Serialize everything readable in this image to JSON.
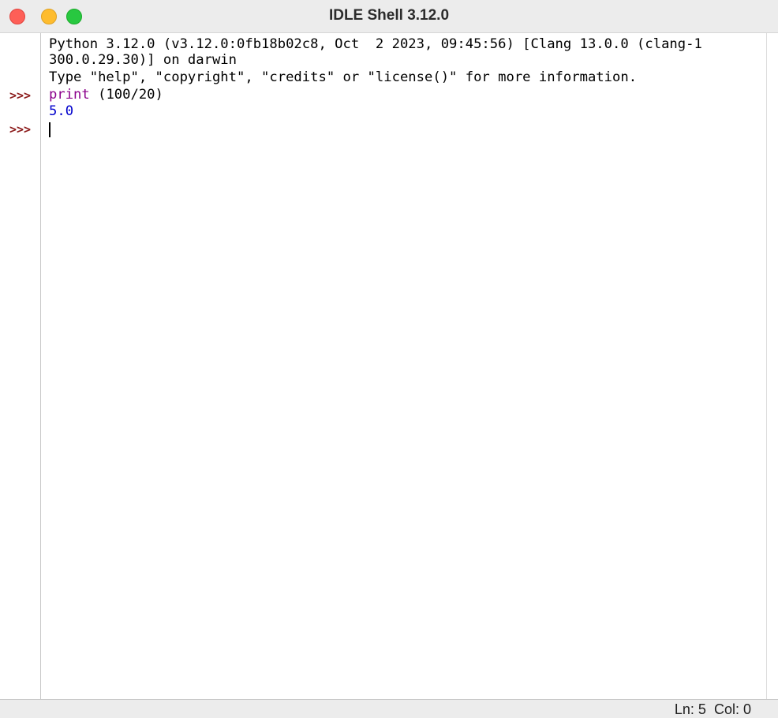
{
  "window": {
    "title": "IDLE Shell 3.12.0"
  },
  "shell": {
    "banner_line1": "Python 3.12.0 (v3.12.0:0fb18b02c8, Oct  2 2023, 09:45:56) [Clang 13.0.0 (clang-1",
    "banner_line2": "300.0.29.30)] on darwin",
    "banner_line3": "Type \"help\", \"copyright\", \"credits\" or \"license()\" for more information.",
    "prompt": ">>>",
    "input_keyword": "print",
    "input_rest": " (100/20)",
    "output": "5.0"
  },
  "status": {
    "line": "Ln: 5",
    "col": "Col: 0"
  },
  "colors": {
    "prompt": "#8b1a1a",
    "keyword": "#8b008b",
    "output": "#0000cc"
  }
}
